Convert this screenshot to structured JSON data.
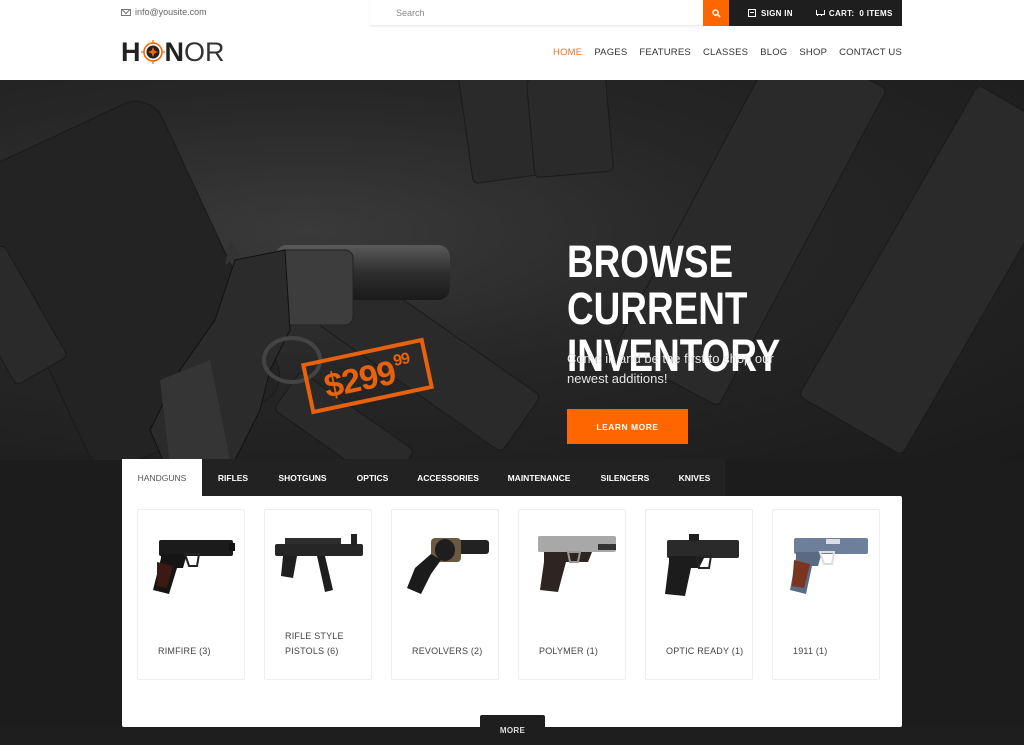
{
  "topbar": {
    "email": "info@yousite.com",
    "search_placeholder": "Search",
    "sign_in": "SIGN IN",
    "cart": "CART:  0 ITEMS"
  },
  "brand": {
    "logo_prefix": "H",
    "logo_suffix_bold": "N",
    "logo_suffix": "OR",
    "accent_color": "#ff6600"
  },
  "nav": {
    "items": [
      {
        "label": "HOME",
        "active": true
      },
      {
        "label": "PAGES"
      },
      {
        "label": "FEATURES"
      },
      {
        "label": "CLASSES"
      },
      {
        "label": "BLOG"
      },
      {
        "label": "SHOP"
      },
      {
        "label": "CONTACT US"
      }
    ]
  },
  "hero": {
    "title_line1": "BROWSE CURRENT",
    "title_line2": "INVENTORY",
    "subtitle": "Come in and be the first to shop our newest additions!",
    "button": "LEARN MORE",
    "price_main": "$299",
    "price_cents": "99",
    "slides": 3,
    "active_slide": 2
  },
  "tabs": {
    "items": [
      {
        "label": "HANDGUNS",
        "active": true
      },
      {
        "label": "RIFLES"
      },
      {
        "label": "SHOTGUNS"
      },
      {
        "label": "OPTICS"
      },
      {
        "label": "ACCESSORIES"
      },
      {
        "label": "MAINTENANCE"
      },
      {
        "label": "SILENCERS"
      },
      {
        "label": "KNIVES"
      }
    ]
  },
  "products": [
    {
      "label": "RIMFIRE (3)",
      "icon": "pistol-1911-black-icon"
    },
    {
      "label": "RIFLE STYLE PISTOLS (6)",
      "icon": "smg-pistol-icon"
    },
    {
      "label": "REVOLVERS (2)",
      "icon": "revolver-icon"
    },
    {
      "label": "POLYMER (1)",
      "icon": "polymer-pistol-icon"
    },
    {
      "label": "OPTIC READY (1)",
      "icon": "optic-ready-pistol-icon"
    },
    {
      "label": "1911 (1)",
      "icon": "pistol-1911-blue-icon"
    }
  ],
  "more_button": "MORE"
}
